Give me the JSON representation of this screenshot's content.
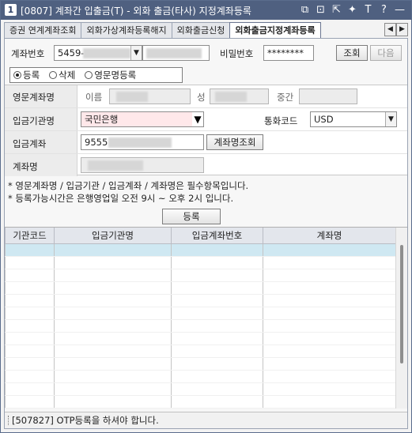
{
  "window": {
    "badge": "1",
    "title": "[0807] 계좌간 입출금(T) - 외화 출금(타사) 지정계좌등록"
  },
  "title_icons": [
    "link-icon",
    "expand-icon",
    "share-icon",
    "pin-icon",
    "font-icon",
    "help-icon",
    "minimize-icon"
  ],
  "title_glyphs": [
    "⧉",
    "⊡",
    "⇱",
    "✦",
    "T",
    "?",
    "—"
  ],
  "tabs": [
    {
      "label": "증권 연계계좌조회"
    },
    {
      "label": "외화가상계좌등록해지"
    },
    {
      "label": "외화출금신청"
    },
    {
      "label": "외화출금지정계좌등록"
    }
  ],
  "tab_nav": {
    "prev": "◀",
    "next": "▶"
  },
  "account": {
    "label": "계좌번호",
    "number": "5459-",
    "password_label": "비밀번호",
    "password": "********",
    "query_button": "조회",
    "next_button": "다음"
  },
  "modes": {
    "options": [
      "등록",
      "삭제",
      "영문명등록"
    ],
    "selected": "등록"
  },
  "form": {
    "english_name_label": "영문계좌명",
    "first_name_label": "이름",
    "last_name_label": "성",
    "middle_name_label": "중간",
    "bank_label": "입금기관명",
    "bank_value": "국민은행",
    "currency_label": "통화코드",
    "currency_value": "USD",
    "deposit_account_label": "입금계좌",
    "deposit_account_value": "9555",
    "account_name_query_button": "계좌명조회",
    "account_name_label": "계좌명"
  },
  "notes": [
    "* 영문계좌명 / 입금기관 / 입금계좌 / 계좌명은 필수항목입니다.",
    "* 등록가능시간은 은행영업일 오전 9시 ~ 오후 2시 입니다."
  ],
  "register_button": "등록",
  "table": {
    "columns": [
      "기관코드",
      "입금기관명",
      "입금계좌번호",
      "계좌명"
    ],
    "rows": []
  },
  "status": "[507827] OTP등록을 하셔야 합니다."
}
